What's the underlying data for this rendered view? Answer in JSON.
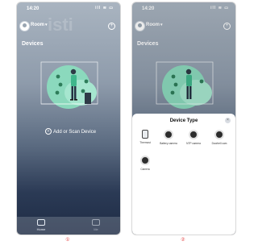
{
  "status_bar": {
    "time": "14:20",
    "icons": "ill ≋ ▭"
  },
  "header": {
    "room_label": "Room",
    "room_chevron": "▾",
    "plus_glyph": "+"
  },
  "main": {
    "title": "Devices",
    "add_button_label": "Add or Scan Device",
    "add_glyph": "+",
    "watermark": "isti"
  },
  "tabbar": {
    "home_label": "Home",
    "me_label": "Me"
  },
  "sheet": {
    "title": "Device Type",
    "close_glyph": "×",
    "items": [
      {
        "label": "Thermost",
        "icon": "thermostat-icon"
      },
      {
        "label": "Battery camera",
        "icon": "battery-camera-icon"
      },
      {
        "label": "NTP camera",
        "icon": "ntp-camera-icon"
      },
      {
        "label": "Doorbell cam",
        "icon": "doorbell-camera-icon"
      },
      {
        "label": "Camera",
        "icon": "camera-icon"
      }
    ]
  },
  "page_numbers": {
    "first": "①",
    "second": "②"
  },
  "colors": {
    "accent_green": "#3fb68b",
    "page_number_red": "#e34040",
    "sheet_bg": "#ffffff"
  }
}
